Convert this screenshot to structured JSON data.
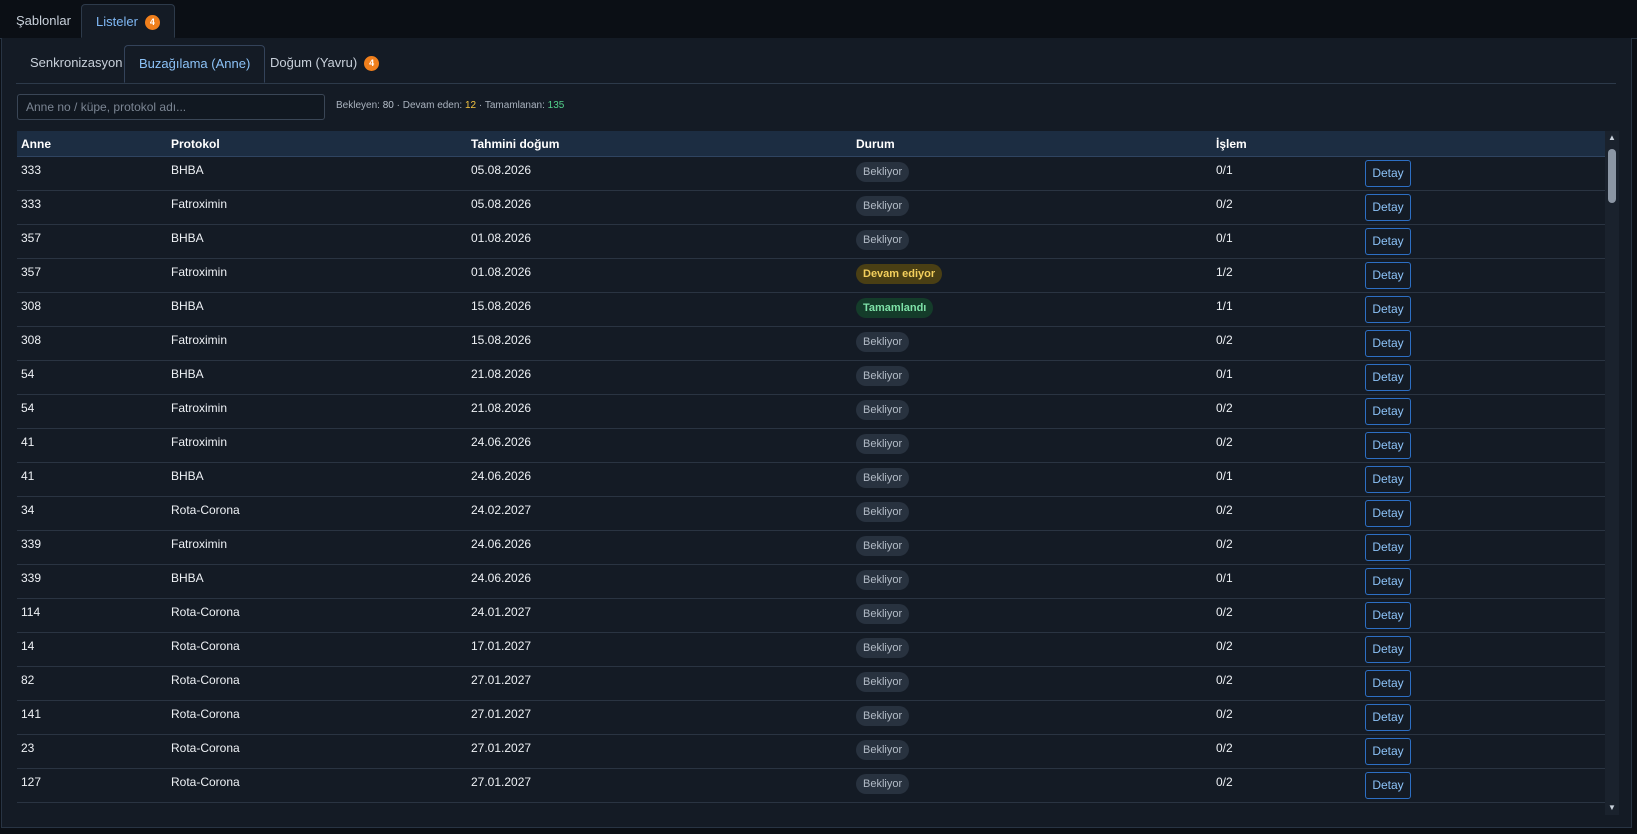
{
  "top_tabs": [
    {
      "label": "Şablonlar"
    },
    {
      "label": "Listeler",
      "badge": "4"
    }
  ],
  "sub_tabs": [
    {
      "label": "Senkronizasyon"
    },
    {
      "label": "Buzağılama (Anne)"
    },
    {
      "label": "Doğum (Yavru)",
      "badge": "4"
    }
  ],
  "search": {
    "placeholder": "Anne no / küpe, protokol adı...",
    "value": ""
  },
  "summary": {
    "waiting_label": "Bekleyen:",
    "waiting": "80",
    "sep": "·",
    "in_progress_label": "Devam eden:",
    "in_progress": "12",
    "done_label": "Tamamlanan:",
    "done": "135"
  },
  "table": {
    "headers": [
      "Anne",
      "Protokol",
      "Tahmini doğum",
      "Durum",
      "İşlem",
      ""
    ],
    "action_label": "Detay",
    "rows": [
      {
        "anne": "333",
        "protokol": "BHBA",
        "tarih": "05.08.2026",
        "durum": "Bekliyor",
        "status": "wait",
        "islem": "0/1"
      },
      {
        "anne": "333",
        "protokol": "Fatroximin",
        "tarih": "05.08.2026",
        "durum": "Bekliyor",
        "status": "wait",
        "islem": "0/2"
      },
      {
        "anne": "357",
        "protokol": "BHBA",
        "tarih": "01.08.2026",
        "durum": "Bekliyor",
        "status": "wait",
        "islem": "0/1"
      },
      {
        "anne": "357",
        "protokol": "Fatroximin",
        "tarih": "01.08.2026",
        "durum": "Devam ediyor",
        "status": "prog",
        "islem": "1/2"
      },
      {
        "anne": "308",
        "protokol": "BHBA",
        "tarih": "15.08.2026",
        "durum": "Tamamlandı",
        "status": "done",
        "islem": "1/1"
      },
      {
        "anne": "308",
        "protokol": "Fatroximin",
        "tarih": "15.08.2026",
        "durum": "Bekliyor",
        "status": "wait",
        "islem": "0/2"
      },
      {
        "anne": "54",
        "protokol": "BHBA",
        "tarih": "21.08.2026",
        "durum": "Bekliyor",
        "status": "wait",
        "islem": "0/1"
      },
      {
        "anne": "54",
        "protokol": "Fatroximin",
        "tarih": "21.08.2026",
        "durum": "Bekliyor",
        "status": "wait",
        "islem": "0/2"
      },
      {
        "anne": "41",
        "protokol": "Fatroximin",
        "tarih": "24.06.2026",
        "durum": "Bekliyor",
        "status": "wait",
        "islem": "0/2"
      },
      {
        "anne": "41",
        "protokol": "BHBA",
        "tarih": "24.06.2026",
        "durum": "Bekliyor",
        "status": "wait",
        "islem": "0/1"
      },
      {
        "anne": "34",
        "protokol": "Rota-Corona",
        "tarih": "24.02.2027",
        "durum": "Bekliyor",
        "status": "wait",
        "islem": "0/2"
      },
      {
        "anne": "339",
        "protokol": "Fatroximin",
        "tarih": "24.06.2026",
        "durum": "Bekliyor",
        "status": "wait",
        "islem": "0/2"
      },
      {
        "anne": "339",
        "protokol": "BHBA",
        "tarih": "24.06.2026",
        "durum": "Bekliyor",
        "status": "wait",
        "islem": "0/1"
      },
      {
        "anne": "114",
        "protokol": "Rota-Corona",
        "tarih": "24.01.2027",
        "durum": "Bekliyor",
        "status": "wait",
        "islem": "0/2"
      },
      {
        "anne": "14",
        "protokol": "Rota-Corona",
        "tarih": "17.01.2027",
        "durum": "Bekliyor",
        "status": "wait",
        "islem": "0/2"
      },
      {
        "anne": "82",
        "protokol": "Rota-Corona",
        "tarih": "27.01.2027",
        "durum": "Bekliyor",
        "status": "wait",
        "islem": "0/2"
      },
      {
        "anne": "141",
        "protokol": "Rota-Corona",
        "tarih": "27.01.2027",
        "durum": "Bekliyor",
        "status": "wait",
        "islem": "0/2"
      },
      {
        "anne": "23",
        "protokol": "Rota-Corona",
        "tarih": "27.01.2027",
        "durum": "Bekliyor",
        "status": "wait",
        "islem": "0/2"
      },
      {
        "anne": "127",
        "protokol": "Rota-Corona",
        "tarih": "27.01.2027",
        "durum": "Bekliyor",
        "status": "wait",
        "islem": "0/2"
      }
    ]
  },
  "scrollbar": {
    "up_icon": "▲",
    "down_icon": "▼"
  },
  "colors": {
    "accent": "#8cc2f7",
    "badge": "#f07f1c",
    "header_bg": "#1c2d42",
    "in_progress": "#f5c542",
    "done": "#53d18b"
  }
}
